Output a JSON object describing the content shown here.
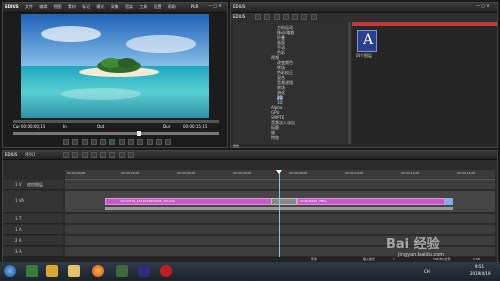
{
  "player": {
    "app_label": "EDIUS",
    "menu": [
      "文件",
      "编辑",
      "视图",
      "素材",
      "标记",
      "模式",
      "采集",
      "渲染",
      "工具",
      "设置",
      "帮助"
    ],
    "mode_label": "PLR",
    "rec_label": "REC",
    "cur_label": "Cur",
    "cur_time": "00:00:00;15",
    "in_label": "In",
    "out_label": "Out",
    "dur_label": "Dur",
    "dur_time": "00:00:15;15"
  },
  "bin": {
    "title": "EDIUS",
    "bin_label": "EDIUS",
    "folders": [
      "方向运动",
      "移动/缩放",
      "折叠",
      "画面",
      "手动",
      "色彩",
      "视频",
      "改变颜色",
      "转场",
      "色彩校正",
      "混合",
      "音频滤镜",
      "转场",
      "溶化",
      "2D",
      "3D",
      "Alpha",
      "GPU",
      "SMPTE",
      "音频淡入淡出",
      "标题",
      "键",
      "特效",
      "亮度",
      "色调",
      "画面"
    ],
    "clip_label": "四个图层",
    "clip_badge": "A",
    "path_label": "特效"
  },
  "timeline": {
    "app_label": "EDIUS",
    "sequence": "序列1",
    "ruler": [
      "00:00:00;00",
      "00:00:02;00",
      "00:00:04;00",
      "00:00:06;00",
      "00:00:08;00",
      "00:00:10;00",
      "00:00:12;00",
      "00:00:14;00"
    ],
    "tracks": [
      {
        "name": "1 V",
        "label": "底纹图层"
      },
      {
        "name": "1 VA",
        "label": "1 VA"
      },
      {
        "name": "1 T",
        "label": "1 T"
      },
      {
        "name": "1 A",
        "label": "1 A"
      },
      {
        "name": "2 A",
        "label": "2 A"
      },
      {
        "name": "3 A",
        "label": "3 A"
      }
    ],
    "clip1": "20120729_1411054815025_rithumb",
    "clip2": "A536n4015_3ff0a",
    "status_left": "暂停",
    "status_right": "插入模式",
    "status_right2": "Y",
    "status_right3": "FLE(80)文件",
    "status_right4": "5:5B"
  },
  "taskbar": {
    "time": "9:51",
    "date": "2019/4/19",
    "tray_label": "CH"
  },
  "watermark": {
    "text": "Bai 经验",
    "url": "jingyan.baidu.com"
  }
}
